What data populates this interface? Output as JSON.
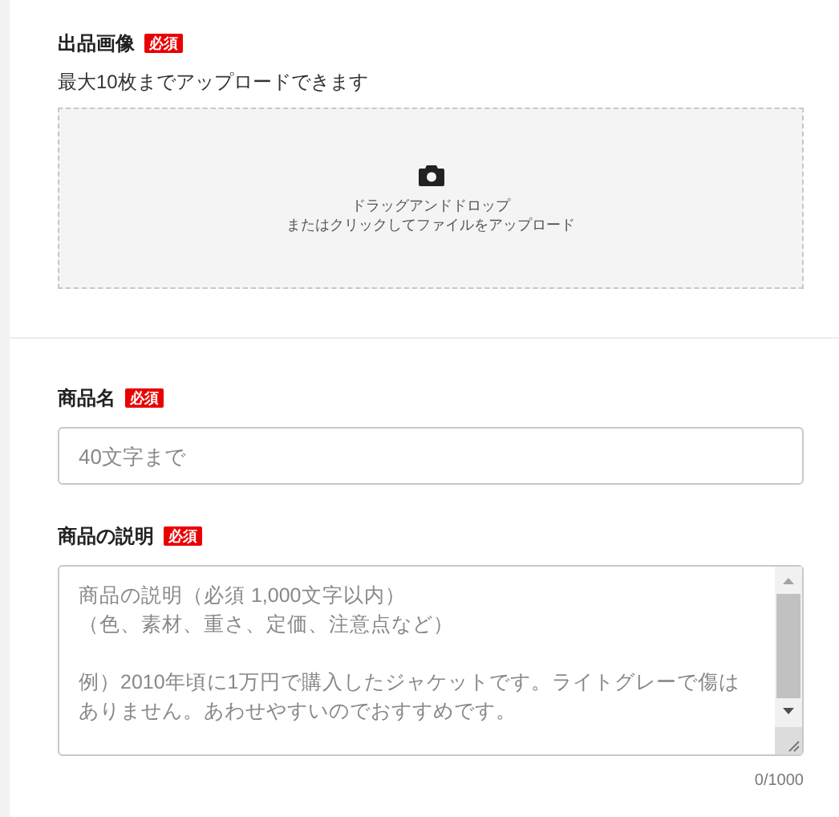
{
  "image_section": {
    "label": "出品画像",
    "badge": "必須",
    "note": "最大10枚までアップロードできます",
    "dropzone": {
      "line_1": "ドラッグアンドドロップ",
      "line_2": "またはクリックしてファイルをアップロード"
    }
  },
  "name_field": {
    "label": "商品名",
    "badge": "必須",
    "placeholder": "40文字まで"
  },
  "description_field": {
    "label": "商品の説明",
    "badge": "必須",
    "placeholder_lines": [
      "商品の説明（必須 1,000文字以内）",
      "（色、素材、重さ、定価、注意点など）",
      "例）2010年頃に1万円で購入したジャケットです。ライトグレーで傷はありません。あわせやすいのでおすすめです。"
    ],
    "counter": "0/1000"
  }
}
